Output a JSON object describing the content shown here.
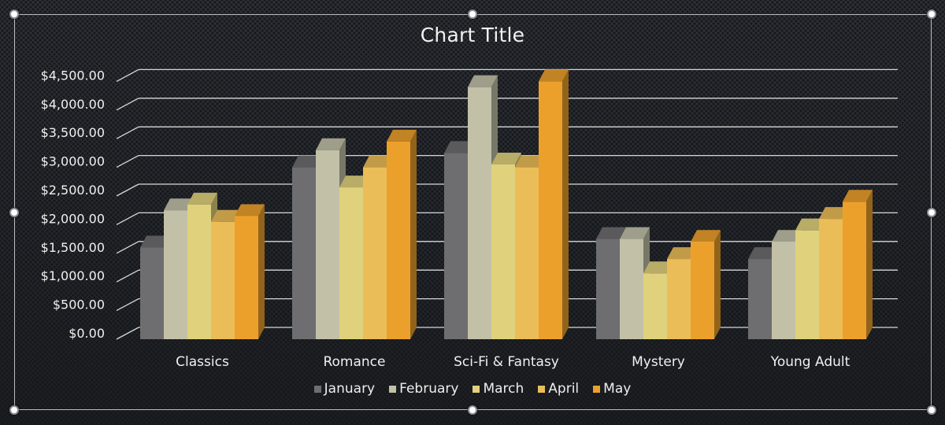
{
  "chart_data": {
    "type": "bar",
    "variant": "3d-clustered-column",
    "title": "Chart Title",
    "xlabel": "",
    "ylabel": "",
    "categories": [
      "Classics",
      "Romance",
      "Sci-Fi & Fantasy",
      "Mystery",
      "Young Adult"
    ],
    "series": [
      {
        "name": "January",
        "color": "#6e6e70",
        "values": [
          1600,
          3000,
          3250,
          1750,
          1400
        ]
      },
      {
        "name": "February",
        "color": "#c2c1a8",
        "values": [
          2250,
          3300,
          4400,
          1750,
          1700
        ]
      },
      {
        "name": "March",
        "color": "#e0d27d",
        "values": [
          2350,
          2650,
          3050,
          1150,
          1900
        ]
      },
      {
        "name": "April",
        "color": "#ebbd58",
        "values": [
          2050,
          3000,
          3000,
          1400,
          2100
        ]
      },
      {
        "name": "May",
        "color": "#eca02c",
        "values": [
          2150,
          3450,
          4500,
          1700,
          2400
        ]
      }
    ],
    "ylim": [
      0,
      4500
    ],
    "yticks": [
      0,
      500,
      1000,
      1500,
      2000,
      2500,
      3000,
      3500,
      4000,
      4500
    ],
    "ytick_labels": [
      "$0.00",
      "$500.00",
      "$1,000.00",
      "$1,500.00",
      "$2,000.00",
      "$2,500.00",
      "$3,000.00",
      "$3,500.00",
      "$4,000.00",
      "$4,500.00"
    ],
    "grid": true,
    "legend_position": "bottom"
  }
}
